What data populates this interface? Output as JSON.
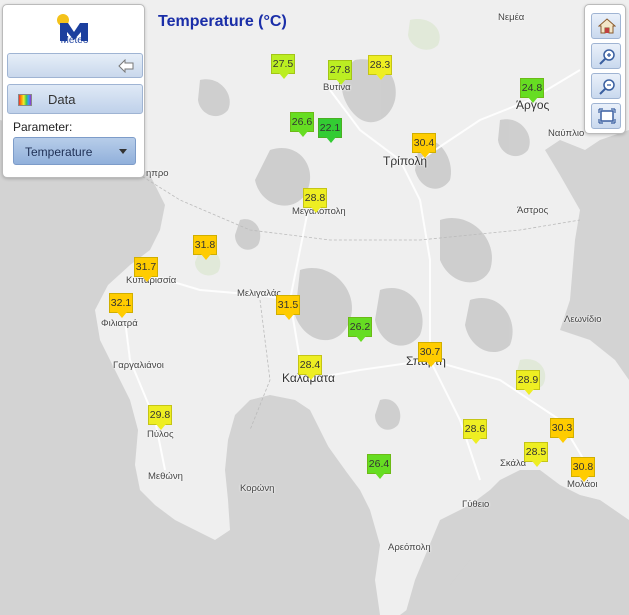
{
  "title": "Temperature (°C)",
  "logo": {
    "text": "Meteo"
  },
  "panel": {
    "data_label": "Data",
    "parameter_label": "Parameter:",
    "parameter_value": "Temperature"
  },
  "colors": {
    "green": "#66dd22",
    "bright_green": "#33cc33",
    "yellow_green": "#bbee22",
    "yellow": "#eeee22",
    "gold": "#ffcc00",
    "title_blue": "#1a2ea8"
  },
  "places": [
    {
      "name": "Νεμέα",
      "big": false
    },
    {
      "name": "Βυτίνα",
      "big": false
    },
    {
      "name": "Άργος",
      "big": true
    },
    {
      "name": "Ναύπλιο",
      "big": false
    },
    {
      "name": "Τρίπολη",
      "big": true
    },
    {
      "name": "Άστρος",
      "big": false
    },
    {
      "name": "Μεγαλόπολη",
      "big": false
    },
    {
      "name": "Κυπαρισσία",
      "big": false
    },
    {
      "name": "Μελιγαλάς",
      "big": false
    },
    {
      "name": "Φιλιατρά",
      "big": false
    },
    {
      "name": "Λεωνίδιο",
      "big": false
    },
    {
      "name": "Γαργαλιάνοι",
      "big": false
    },
    {
      "name": "Καλαμάτα",
      "big": true
    },
    {
      "name": "Σπάρτη",
      "big": true
    },
    {
      "name": "Πύλος",
      "big": false
    },
    {
      "name": "Σκάλα",
      "big": false
    },
    {
      "name": "Μεθώνη",
      "big": false
    },
    {
      "name": "Κορώνη",
      "big": false
    },
    {
      "name": "Μολάοι",
      "big": false
    },
    {
      "name": "Γύθειο",
      "big": false
    },
    {
      "name": "Αρεόπολη",
      "big": false
    },
    {
      "name": "ηπρο",
      "big": false
    }
  ],
  "stations": [
    {
      "value": "27.5",
      "color": "yellow_green"
    },
    {
      "value": "27.8",
      "color": "yellow_green"
    },
    {
      "value": "28.3",
      "color": "yellow"
    },
    {
      "value": "24.8",
      "color": "green"
    },
    {
      "value": "26.6",
      "color": "green"
    },
    {
      "value": "22.1",
      "color": "bright_green"
    },
    {
      "value": "30.4",
      "color": "gold"
    },
    {
      "value": "28.8",
      "color": "yellow"
    },
    {
      "value": "31.8",
      "color": "gold"
    },
    {
      "value": "31.7",
      "color": "gold"
    },
    {
      "value": "32.1",
      "color": "gold"
    },
    {
      "value": "31.5",
      "color": "gold"
    },
    {
      "value": "26.2",
      "color": "green"
    },
    {
      "value": "28.4",
      "color": "yellow"
    },
    {
      "value": "30.7",
      "color": "gold"
    },
    {
      "value": "28.9",
      "color": "yellow"
    },
    {
      "value": "29.8",
      "color": "yellow"
    },
    {
      "value": "28.6",
      "color": "yellow"
    },
    {
      "value": "30.3",
      "color": "gold"
    },
    {
      "value": "28.5",
      "color": "yellow"
    },
    {
      "value": "30.8",
      "color": "gold"
    },
    {
      "value": "26.4",
      "color": "green"
    }
  ]
}
